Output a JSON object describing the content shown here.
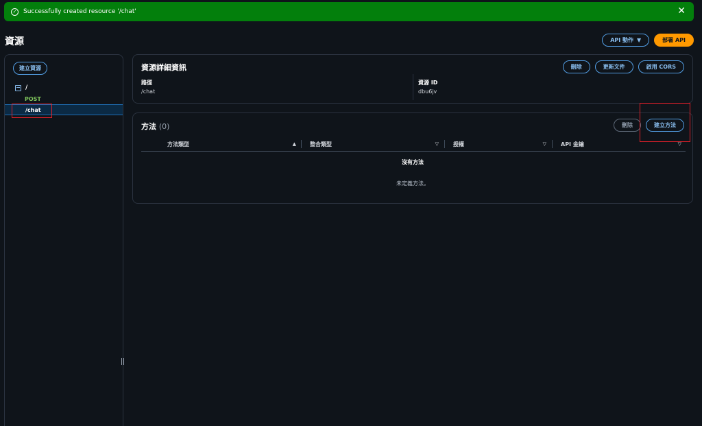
{
  "flash": {
    "message": "Successfully created resource '/chat'",
    "status_color": "#037f0c",
    "icon": "check-circle-icon",
    "close_glyph": "✕"
  },
  "page": {
    "title": "資源",
    "api_actions_label": "API 動作",
    "deploy_label": "部署 API"
  },
  "sidebar": {
    "create_resource_label": "建立資源",
    "tree": {
      "root": "/",
      "root_method": "POST",
      "child": "/chat"
    }
  },
  "details": {
    "title": "資源詳細資訊",
    "delete_label": "刪除",
    "update_docs_label": "更新文件",
    "enable_cors_label": "啟用 CORS",
    "path_label": "路徑",
    "path_value": "/chat",
    "resource_id_label": "資源 ID",
    "resource_id_value": "dbu6jv"
  },
  "methods": {
    "title": "方法",
    "count": "(0)",
    "delete_label": "刪除",
    "create_method_label": "建立方法",
    "columns": [
      "方法類型",
      "整合類型",
      "授權",
      "API 金鑰"
    ],
    "empty_title": "沒有方法",
    "empty_desc": "未定義方法。"
  },
  "colors": {
    "accent": "#539fe5",
    "primary": "#ff9900",
    "method_post": "#7fc45c",
    "annotation": "#e0202a"
  }
}
